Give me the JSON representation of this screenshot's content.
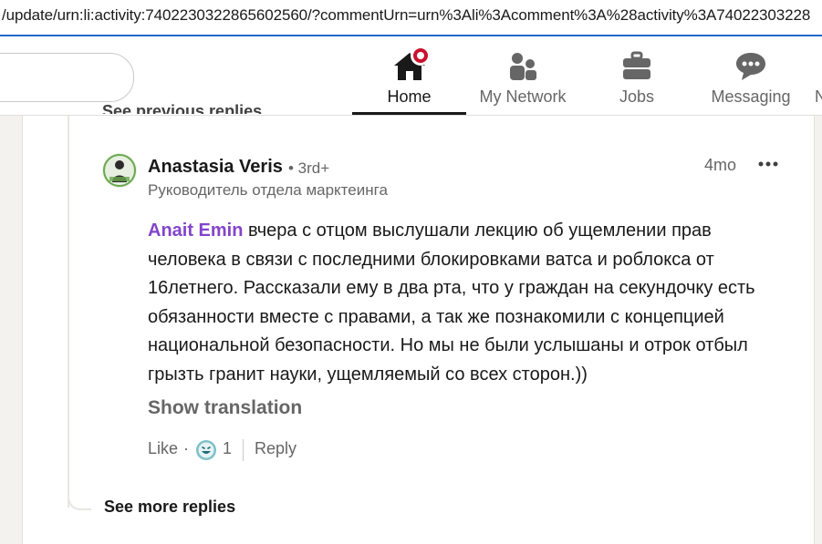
{
  "browser": {
    "url": "/update/urn:li:activity:7402230322865602560/?commentUrn=urn%3Ali%3Acomment%3A%28activity%3A74022303228"
  },
  "nav": {
    "items": [
      {
        "label": "Home",
        "icon": "home-icon",
        "active": true
      },
      {
        "label": "My Network",
        "icon": "network-icon"
      },
      {
        "label": "Jobs",
        "icon": "briefcase-icon"
      },
      {
        "label": "Messaging",
        "icon": "messaging-icon"
      },
      {
        "label": "N",
        "icon": "notifications-icon"
      }
    ]
  },
  "thread": {
    "see_previous_label": "See previous replies",
    "see_more_label": "See more replies"
  },
  "comment": {
    "author": "Anastasia Veris",
    "degree": "• 3rd+",
    "headline": "Руководитель отдела марктеинга",
    "time": "4mo",
    "mention": "Anait Emin",
    "text": " вчера с отцом выслушали лекцию об ущемлении прав человека в связи с последними блокировками ватса и роблокса от 16летнего. Рассказали ему в два рта, что у граждан на секундочку есть обязанности вместе с правами, а так же познакомили с концепцией национальной безопасности. Но мы не были услышаны и отрок отбыл грызть гранит науки, ущемляемый со всех сторон.))",
    "show_translation": "Show translation",
    "like_label": "Like",
    "separator": "·",
    "reaction_count": "1",
    "reply_label": "Reply"
  },
  "colors": {
    "accent_blue": "#1b66c9",
    "badge_red": "#cb112d",
    "mention_purple": "#8344cc"
  }
}
